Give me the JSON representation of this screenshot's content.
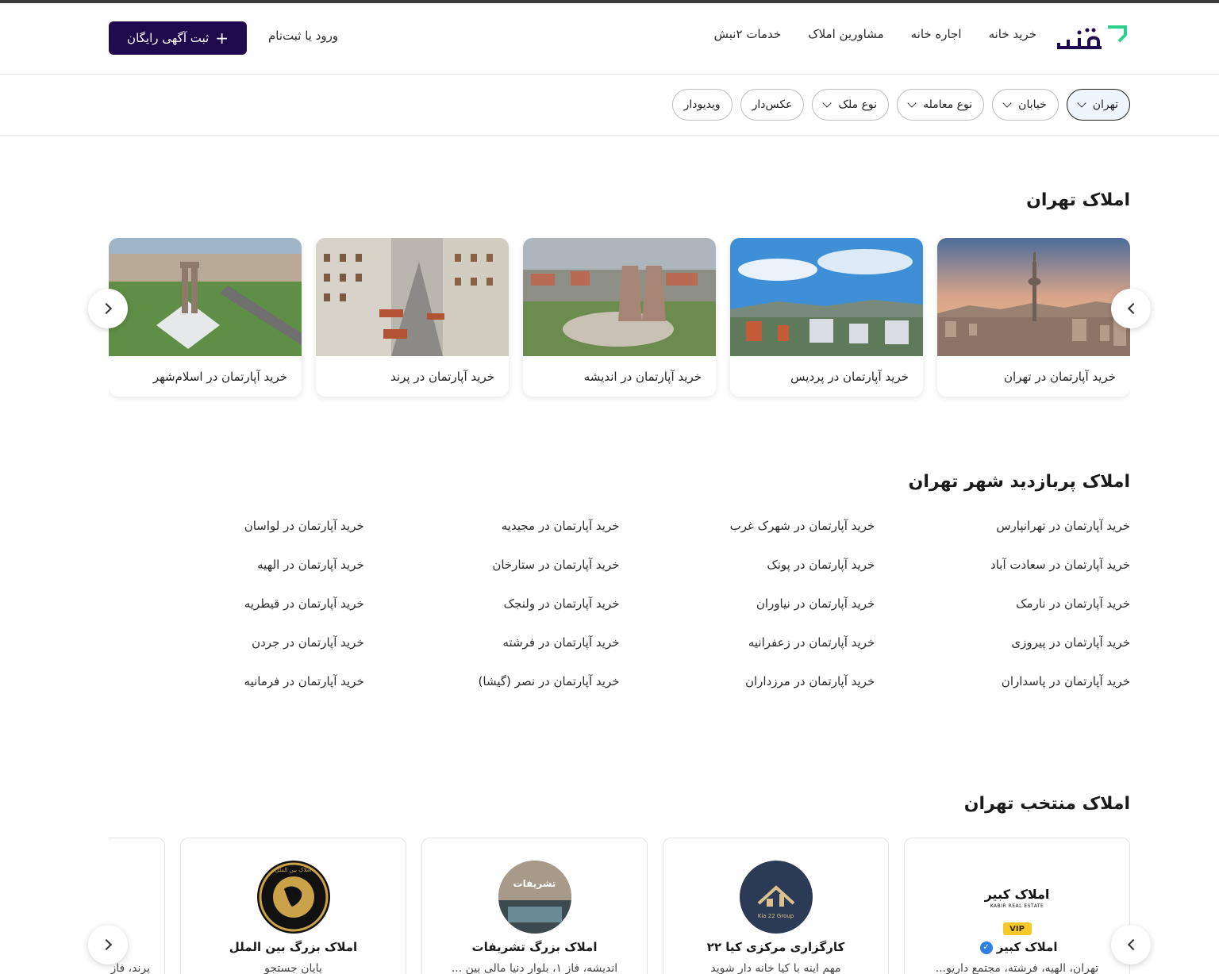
{
  "header": {
    "logo_text": "نبش۲",
    "nav": [
      "خرید خانه",
      "اجاره خانه",
      "مشاورین املاک",
      "خدمات ۲نبش"
    ],
    "login": "ورود یا ثبت‌نام",
    "post_ad": "ثبت آگهی رایگان"
  },
  "filters": [
    {
      "label": "تهران",
      "dropdown": true,
      "active": true
    },
    {
      "label": "خیابان",
      "dropdown": true
    },
    {
      "label": "نوع معامله",
      "dropdown": true
    },
    {
      "label": "نوع ملک",
      "dropdown": true
    },
    {
      "label": "عکس‌دار",
      "dropdown": false
    },
    {
      "label": "ویدیودار",
      "dropdown": false
    }
  ],
  "cities_section": {
    "title": "املاک تهران",
    "cards": [
      "خرید آپارتمان در تهران",
      "خرید آپارتمان در پردیس",
      "خرید آپارتمان در اندیشه",
      "خرید آپارتمان در پرند",
      "خرید آپارتمان در اسلام‌شهر"
    ]
  },
  "popular_section": {
    "title": "املاک پربازدید شهر تهران",
    "columns": [
      [
        "خرید آپارتمان در تهرانپارس",
        "خرید آپارتمان در سعادت آباد",
        "خرید آپارتمان در نارمک",
        "خرید آپارتمان در پیروزی",
        "خرید آپارتمان در پاسداران"
      ],
      [
        "خرید آپارتمان در شهرک غرب",
        "خرید آپارتمان در پونک",
        "خرید آپارتمان در نیاوران",
        "خرید آپارتمان در زعفرانیه",
        "خرید آپارتمان در مرزداران"
      ],
      [
        "خرید آپارتمان در مجیدیه",
        "خرید آپارتمان در ستارخان",
        "خرید آپارتمان در ولنجک",
        "خرید آپارتمان در فرشته",
        "خرید آپارتمان در نصر (گیشا)"
      ],
      [
        "خرید آپارتمان در لواسان",
        "خرید آپارتمان در الهیه",
        "خرید آپارتمان در قیطریه",
        "خرید آپارتمان در جردن",
        "خرید آپارتمان در فرمانیه"
      ]
    ]
  },
  "agencies_section": {
    "title": "املاک منتخب تهران",
    "cards": [
      {
        "name": "املاک کبیر",
        "address": "تهران، الهیه، فرشته، مجتمع داریو...",
        "vip": "VIP",
        "logo_text": "املاک کبیر",
        "logo_sub": "KABIR REAL ESTATE"
      },
      {
        "name": "کارگزاری مرکزی کیا ۲۲",
        "address": "مهم اینه با کیا خانه دار شوید",
        "logo_sub": "Kia 22 Group"
      },
      {
        "name": "املاک بزرگ تشریفات",
        "address": "اندیشه، فاز ۱، بلوار دنیا مالی بین ...",
        "logo_text": "تشریفات"
      },
      {
        "name": "املاک بزرگ بین الملل",
        "address": "پایان جستجو",
        "logo_text": "املاک بین الملل"
      },
      {
        "name": "",
        "address": "پرند، فاز"
      }
    ]
  }
}
